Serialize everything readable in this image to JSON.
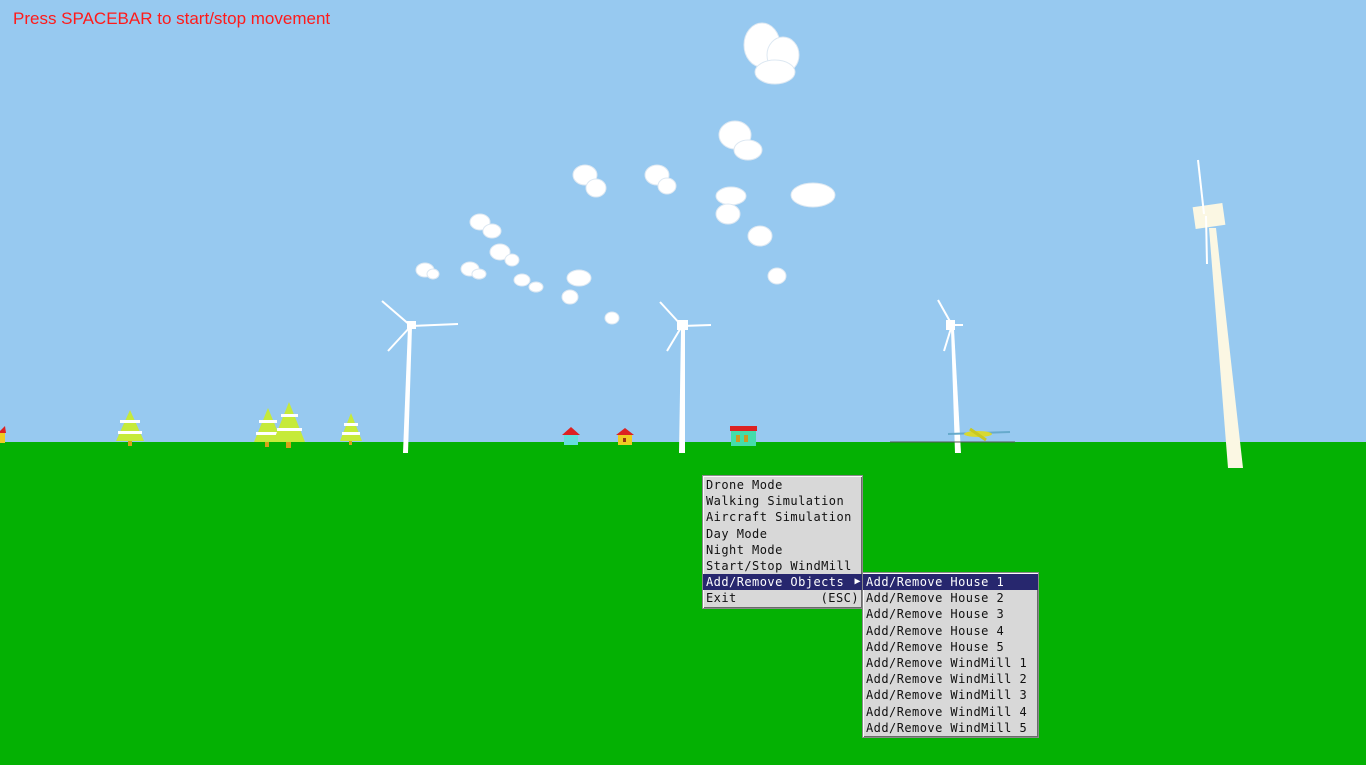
{
  "hint_text": "Press SPACEBAR to start/stop movement",
  "colors": {
    "sky": "#97c9f0",
    "ground": "#04b103",
    "hint": "#ff1a1a",
    "menu_bg": "#d8d8d8",
    "menu_highlight": "#27276e"
  },
  "main_menu": {
    "items": [
      {
        "label": "Drone Mode",
        "shortcut": ""
      },
      {
        "label": "Walking Simulation",
        "shortcut": ""
      },
      {
        "label": "Aircraft Simulation",
        "shortcut": ""
      },
      {
        "label": "Day Mode",
        "shortcut": ""
      },
      {
        "label": "Night Mode",
        "shortcut": ""
      },
      {
        "label": "Start/Stop WindMill",
        "shortcut": ""
      },
      {
        "label": "Add/Remove Objects",
        "shortcut": "▶"
      },
      {
        "label": "Exit",
        "shortcut": "(ESC)"
      }
    ]
  },
  "sub_menu": {
    "items": [
      {
        "label": "Add/Remove House 1"
      },
      {
        "label": "Add/Remove House 2"
      },
      {
        "label": "Add/Remove House 3"
      },
      {
        "label": "Add/Remove House 4"
      },
      {
        "label": "Add/Remove House 5"
      },
      {
        "label": "Add/Remove WindMill 1"
      },
      {
        "label": "Add/Remove WindMill 2"
      },
      {
        "label": "Add/Remove WindMill 3"
      },
      {
        "label": "Add/Remove WindMill 4"
      },
      {
        "label": "Add/Remove WindMill 5"
      }
    ]
  }
}
